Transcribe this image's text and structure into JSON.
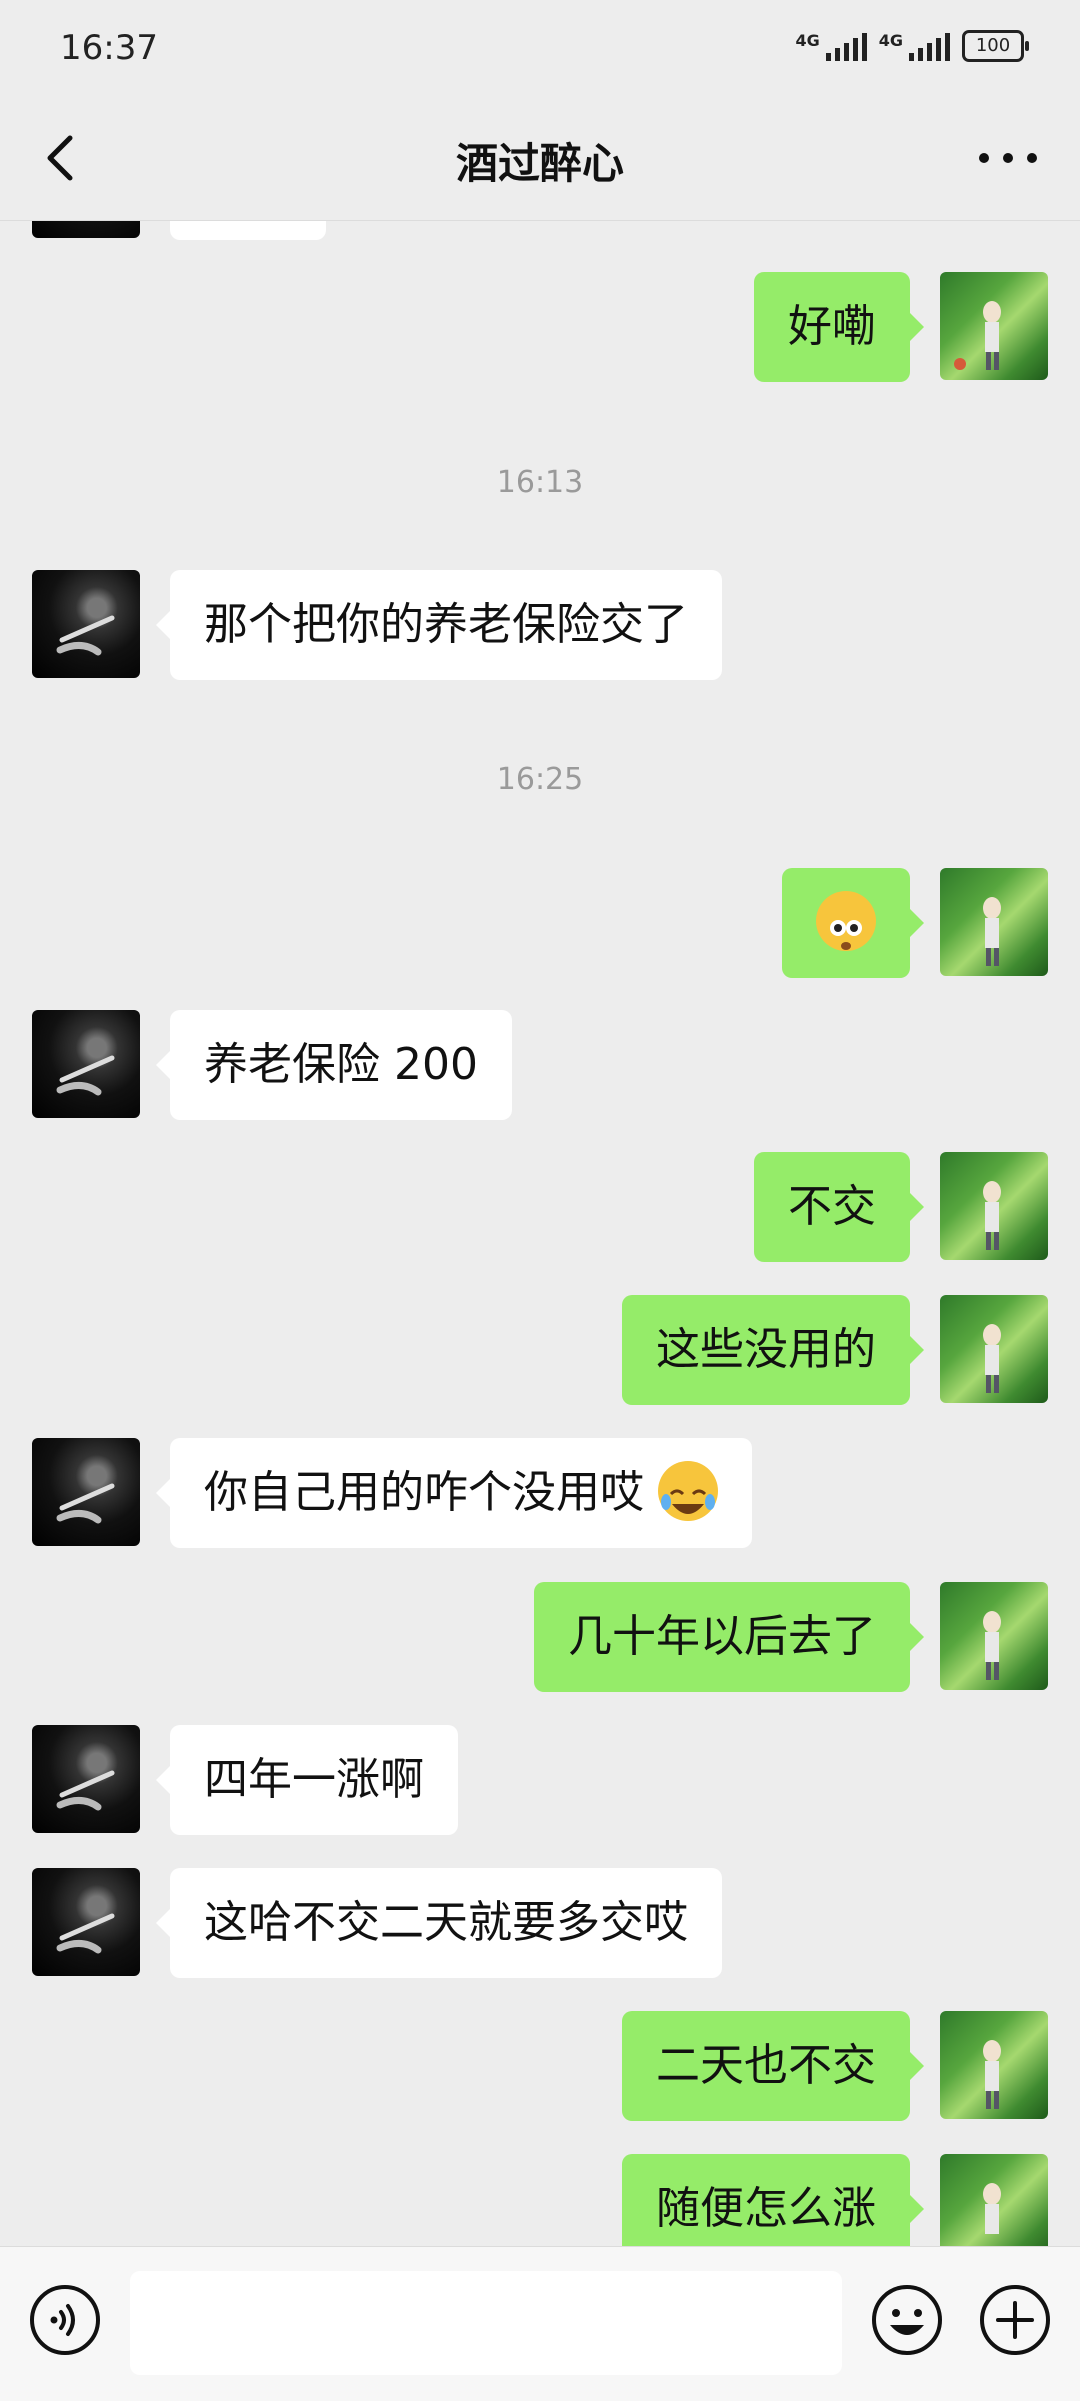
{
  "status_bar": {
    "time": "16:37",
    "network1": "4G",
    "network2": "4G",
    "battery": "100"
  },
  "nav": {
    "title": "酒过醉心"
  },
  "messages": [
    {
      "id": "m1",
      "side": "out",
      "text": "好嘞"
    },
    {
      "id": "t1",
      "type": "timestamp",
      "text": "16:13"
    },
    {
      "id": "m2",
      "side": "in",
      "text": "那个把你的养老保险交了"
    },
    {
      "id": "t2",
      "type": "timestamp",
      "text": "16:25"
    },
    {
      "id": "m3",
      "side": "out",
      "emoji": "confused-face-emoji"
    },
    {
      "id": "m4",
      "side": "in",
      "text": "养老保险 200"
    },
    {
      "id": "m5",
      "side": "out",
      "text": "不交"
    },
    {
      "id": "m6",
      "side": "out",
      "text": "这些没用的"
    },
    {
      "id": "m7",
      "side": "in",
      "text": "你自己用的咋个没用哎",
      "emoji": "tears-of-joy-emoji"
    },
    {
      "id": "m8",
      "side": "out",
      "text": "几十年以后去了"
    },
    {
      "id": "m9",
      "side": "in",
      "text": "四年一涨啊"
    },
    {
      "id": "m10",
      "side": "in",
      "text": "这哈不交二天就要多交哎"
    },
    {
      "id": "m11",
      "side": "out",
      "text": "二天也不交"
    },
    {
      "id": "m12",
      "side": "out",
      "text": "随便怎么涨"
    }
  ],
  "input": {
    "placeholder": ""
  },
  "icons": {
    "back": "chevron-left-icon",
    "more": "more-dots-icon",
    "voice": "voice-icon",
    "emoji": "emoji-icon",
    "plus": "plus-icon"
  },
  "colors": {
    "background": "#ededed",
    "outgoing_bubble": "#95ec69",
    "incoming_bubble": "#ffffff"
  }
}
